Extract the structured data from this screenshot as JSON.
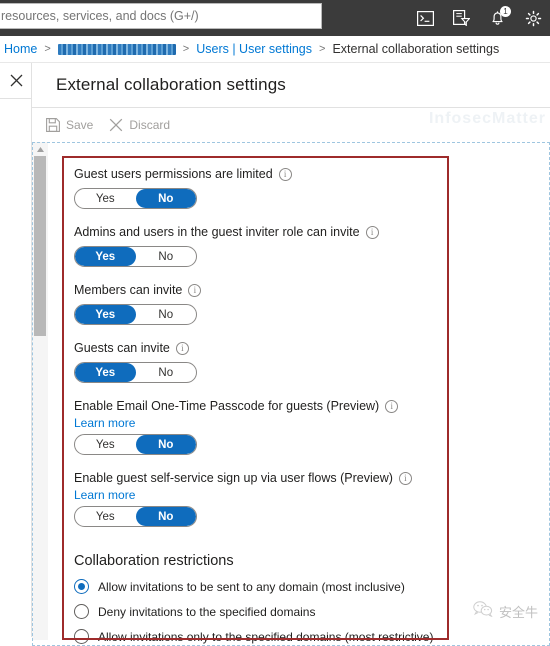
{
  "topbar": {
    "search": {
      "value": "",
      "placeholder": "resources, services, and docs (G+/)"
    },
    "icons": [
      {
        "name": "cloud-shell-icon",
        "title": "Cloud Shell"
      },
      {
        "name": "directory-filter-icon",
        "title": "Directories + subscriptions"
      },
      {
        "name": "notifications-bell-icon",
        "title": "Notifications",
        "badge": "1"
      },
      {
        "name": "settings-gear-icon",
        "title": "Settings"
      }
    ]
  },
  "breadcrumb": {
    "home": "Home",
    "redacted": "",
    "users": "Users | User settings",
    "current": "External collaboration settings",
    "separator": ">"
  },
  "blade": {
    "close_label": "Close",
    "title": "External collaboration settings",
    "commands": {
      "save_label": "Save",
      "discard_label": "Discard"
    },
    "watermark": "InfosecMatter"
  },
  "settings": [
    {
      "label": "Guest users permissions are limited",
      "learn_more": null,
      "options": [
        "Yes",
        "No"
      ],
      "value": "No"
    },
    {
      "label": "Admins and users in the guest inviter role can invite",
      "learn_more": null,
      "options": [
        "Yes",
        "No"
      ],
      "value": "Yes"
    },
    {
      "label": "Members can invite",
      "learn_more": null,
      "options": [
        "Yes",
        "No"
      ],
      "value": "Yes"
    },
    {
      "label": "Guests can invite",
      "learn_more": null,
      "options": [
        "Yes",
        "No"
      ],
      "value": "Yes"
    },
    {
      "label": "Enable Email One-Time Passcode for guests (Preview)",
      "learn_more": "Learn more",
      "options": [
        "Yes",
        "No"
      ],
      "value": "No"
    },
    {
      "label": "Enable guest self-service sign up via user flows (Preview)",
      "learn_more": "Learn more",
      "options": [
        "Yes",
        "No"
      ],
      "value": "No"
    }
  ],
  "collaboration": {
    "heading": "Collaboration restrictions",
    "options": [
      {
        "label": "Allow invitations to be sent to any domain (most inclusive)",
        "selected": true
      },
      {
        "label": "Deny invitations to the specified domains",
        "selected": false
      },
      {
        "label": "Allow invitations only to the specified domains (most restrictive)",
        "selected": false
      }
    ]
  },
  "overlays": {
    "wechat_text": "安全牛"
  },
  "colors": {
    "accent": "#0f6cbd",
    "link": "#0078d4",
    "topbar_bg": "#3b3b3b",
    "annotation_red": "#9e2b2b"
  }
}
